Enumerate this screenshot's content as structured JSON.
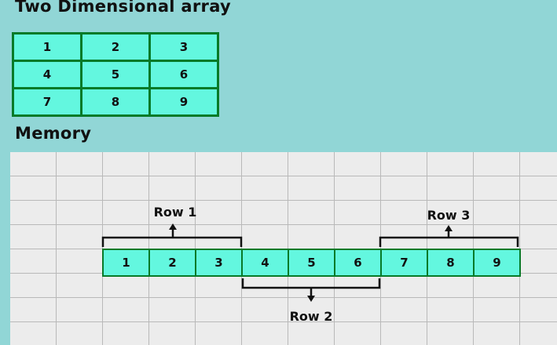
{
  "titles": {
    "array": "Two Dimensional array",
    "memory": "Memory"
  },
  "array_2d": [
    [
      "1",
      "2",
      "3"
    ],
    [
      "4",
      "5",
      "6"
    ],
    [
      "7",
      "8",
      "9"
    ]
  ],
  "memory_cells": [
    "1",
    "2",
    "3",
    "4",
    "5",
    "6",
    "7",
    "8",
    "9"
  ],
  "row_labels": {
    "row1": "Row 1",
    "row2": "Row 2",
    "row3": "Row 3"
  },
  "colors": {
    "background": "#91d6d6",
    "cell_fill": "#63f7df",
    "cell_border": "#087a28",
    "memory_bg": "#ececec",
    "grid_line": "#b9b9b9"
  }
}
